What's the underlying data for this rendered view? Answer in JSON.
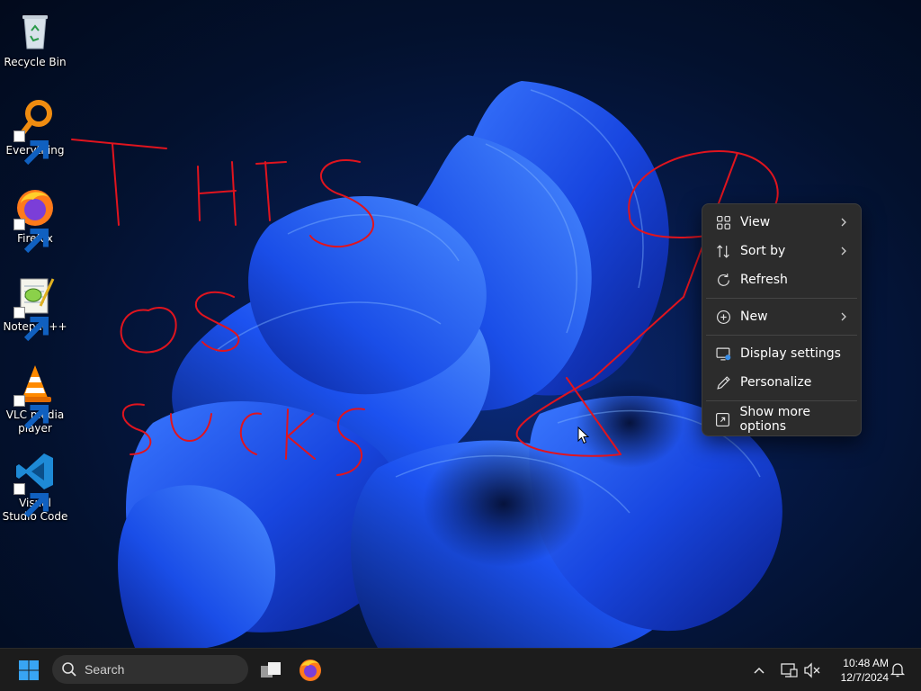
{
  "desktop": {
    "icons": [
      {
        "label": "Recycle Bin",
        "icon": "recycle-bin-icon",
        "shortcut": false
      },
      {
        "label": "Everything",
        "icon": "everything-search-icon",
        "shortcut": true
      },
      {
        "label": "Firefox",
        "icon": "firefox-icon",
        "shortcut": true
      },
      {
        "label": "Notepad++",
        "icon": "notepad-plus-plus-icon",
        "shortcut": true
      },
      {
        "label": "VLC media player",
        "icon": "vlc-icon",
        "shortcut": true
      },
      {
        "label": "Visual Studio Code",
        "icon": "vscode-icon",
        "shortcut": true
      }
    ],
    "annotation_strokes_color": "#e0141e"
  },
  "context_menu": {
    "items": [
      {
        "label": "View",
        "icon": "grid-view-icon",
        "submenu": true
      },
      {
        "label": "Sort by",
        "icon": "sort-icon",
        "submenu": true
      },
      {
        "label": "Refresh",
        "icon": "refresh-icon",
        "submenu": false
      },
      {
        "label": "New",
        "icon": "plus-circle-icon",
        "submenu": true
      },
      {
        "label": "Display settings",
        "icon": "display-settings-icon",
        "submenu": false
      },
      {
        "label": "Personalize",
        "icon": "pen-icon",
        "submenu": false
      },
      {
        "label": "Show more options",
        "icon": "show-more-options-icon",
        "submenu": false
      }
    ]
  },
  "taskbar": {
    "search_placeholder": "Search",
    "clock": {
      "time": "10:48 AM",
      "date": "12/7/2024"
    },
    "accent_color": "#0078d4"
  }
}
